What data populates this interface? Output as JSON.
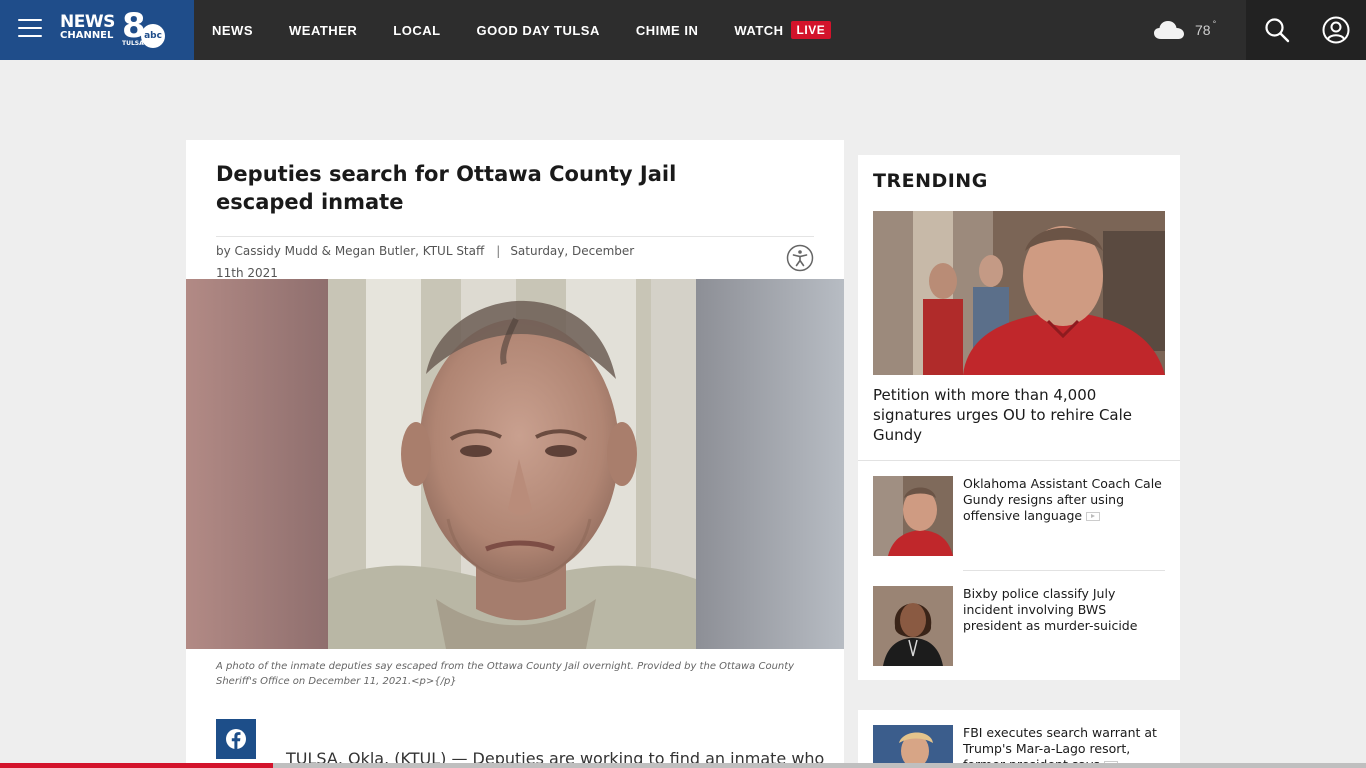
{
  "header": {
    "menu_label": "Menu",
    "logo": {
      "line1": "NEWS",
      "line2": "CHANNEL",
      "number": "8",
      "network": "abc",
      "city": "TULSA"
    },
    "nav": [
      {
        "label": "NEWS"
      },
      {
        "label": "WEATHER"
      },
      {
        "label": "LOCAL"
      },
      {
        "label": "GOOD DAY TULSA"
      },
      {
        "label": "CHIME IN"
      },
      {
        "label": "WATCH",
        "badge": "LIVE"
      }
    ],
    "weather": {
      "icon": "cloud-icon",
      "temperature": "78",
      "unit": "°"
    },
    "icons": [
      "search-icon",
      "account-icon"
    ],
    "colors": {
      "bar": "#2d2d2d",
      "brand": "#1f4d8a",
      "live": "#d3132b"
    }
  },
  "article": {
    "headline": "Deputies search for Ottawa County Jail escaped inmate",
    "byline": {
      "authors": "by Cassidy Mudd & Megan Butler, KTUL Staff",
      "separator": "|",
      "date": "Saturday, December 11th 2021"
    },
    "hero_image": "Mugshot of the escaped inmate",
    "caption": "A photo of the inmate deputies say escaped from the Ottawa County Jail overnight. Provided by the Ottawa County Sheriff's Office on December 11, 2021.<p>{/p}",
    "share_icon": "facebook-icon",
    "lede": "TULSA, Okla. (KTUL) — Deputies are working to find an inmate who"
  },
  "trending": {
    "title": "TRENDING",
    "lead": {
      "title": "Petition with more than 4,000 signatures urges OU to rehire Cale Gundy"
    },
    "items": [
      {
        "title": "Oklahoma Assistant Coach Cale Gundy resigns after using offensive language",
        "has_video": true
      },
      {
        "title": "Bixby police classify July incident involving BWS president as murder-suicide",
        "has_video": false
      },
      {
        "title": "FBI executes search warrant at Trump's Mar-a-Lago resort, former president says",
        "has_video": true
      }
    ]
  },
  "read_progress": 0.2
}
